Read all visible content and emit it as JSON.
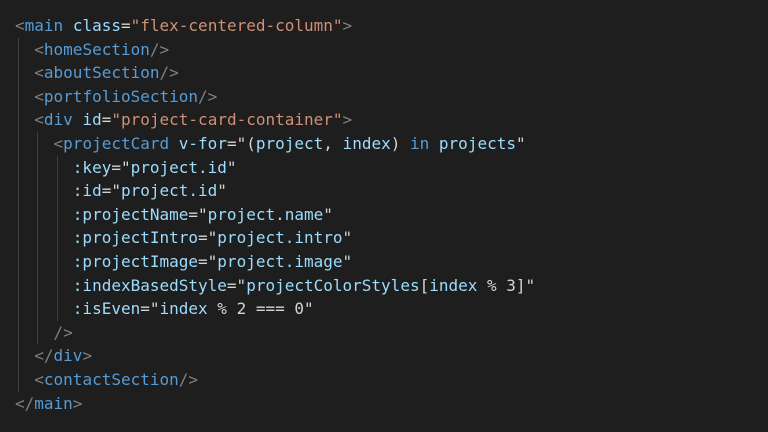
{
  "editor": {
    "language": "vue-html",
    "theme_colors": {
      "background": "#1e1e1e",
      "punctuation": "#808080",
      "tag": "#569cd6",
      "attribute": "#9cdcfe",
      "string": "#ce9178",
      "text": "#d4d4d4",
      "indent_guide": "#404040"
    },
    "lines": [
      {
        "indent": 0,
        "tokens": [
          {
            "t": "punct",
            "v": "<"
          },
          {
            "t": "tag",
            "v": "main"
          },
          {
            "t": "text",
            "v": " "
          },
          {
            "t": "attr",
            "v": "class"
          },
          {
            "t": "text",
            "v": "="
          },
          {
            "t": "str",
            "v": "\"flex-centered-column\""
          },
          {
            "t": "punct",
            "v": ">"
          }
        ]
      },
      {
        "indent": 1,
        "tokens": [
          {
            "t": "punct",
            "v": "<"
          },
          {
            "t": "tag",
            "v": "homeSection"
          },
          {
            "t": "punct",
            "v": "/>"
          }
        ]
      },
      {
        "indent": 1,
        "tokens": [
          {
            "t": "punct",
            "v": "<"
          },
          {
            "t": "tag",
            "v": "aboutSection"
          },
          {
            "t": "punct",
            "v": "/>"
          }
        ]
      },
      {
        "indent": 1,
        "tokens": [
          {
            "t": "punct",
            "v": "<"
          },
          {
            "t": "tag",
            "v": "portfolioSection"
          },
          {
            "t": "punct",
            "v": "/>"
          }
        ]
      },
      {
        "indent": 1,
        "tokens": [
          {
            "t": "punct",
            "v": "<"
          },
          {
            "t": "tag",
            "v": "div"
          },
          {
            "t": "text",
            "v": " "
          },
          {
            "t": "attr",
            "v": "id"
          },
          {
            "t": "text",
            "v": "="
          },
          {
            "t": "str",
            "v": "\"project-card-container\""
          },
          {
            "t": "punct",
            "v": ">"
          }
        ]
      },
      {
        "indent": 2,
        "tokens": [
          {
            "t": "punct",
            "v": "<"
          },
          {
            "t": "tag",
            "v": "projectCard"
          },
          {
            "t": "text",
            "v": " "
          },
          {
            "t": "attr",
            "v": "v-for"
          },
          {
            "t": "text",
            "v": "=\"("
          },
          {
            "t": "var",
            "v": "project"
          },
          {
            "t": "text",
            "v": ", "
          },
          {
            "t": "var",
            "v": "index"
          },
          {
            "t": "text",
            "v": ") "
          },
          {
            "t": "kw",
            "v": "in"
          },
          {
            "t": "text",
            "v": " "
          },
          {
            "t": "var",
            "v": "projects"
          },
          {
            "t": "text",
            "v": "\""
          }
        ]
      },
      {
        "indent": 3,
        "tokens": [
          {
            "t": "attr",
            "v": ":key"
          },
          {
            "t": "text",
            "v": "=\""
          },
          {
            "t": "var",
            "v": "project.id"
          },
          {
            "t": "text",
            "v": "\""
          }
        ]
      },
      {
        "indent": 3,
        "tokens": [
          {
            "t": "attr",
            "v": ":id"
          },
          {
            "t": "text",
            "v": "=\""
          },
          {
            "t": "var",
            "v": "project.id"
          },
          {
            "t": "text",
            "v": "\""
          }
        ]
      },
      {
        "indent": 3,
        "tokens": [
          {
            "t": "attr",
            "v": ":projectName"
          },
          {
            "t": "text",
            "v": "=\""
          },
          {
            "t": "var",
            "v": "project.name"
          },
          {
            "t": "text",
            "v": "\""
          }
        ]
      },
      {
        "indent": 3,
        "tokens": [
          {
            "t": "attr",
            "v": ":projectIntro"
          },
          {
            "t": "text",
            "v": "=\""
          },
          {
            "t": "var",
            "v": "project.intro"
          },
          {
            "t": "text",
            "v": "\""
          }
        ]
      },
      {
        "indent": 3,
        "tokens": [
          {
            "t": "attr",
            "v": ":projectImage"
          },
          {
            "t": "text",
            "v": "=\""
          },
          {
            "t": "var",
            "v": "project.image"
          },
          {
            "t": "text",
            "v": "\""
          }
        ]
      },
      {
        "indent": 3,
        "tokens": [
          {
            "t": "attr",
            "v": ":indexBasedStyle"
          },
          {
            "t": "text",
            "v": "=\""
          },
          {
            "t": "var",
            "v": "projectColorStyles"
          },
          {
            "t": "text",
            "v": "["
          },
          {
            "t": "var",
            "v": "index"
          },
          {
            "t": "text",
            "v": " % 3]\""
          }
        ]
      },
      {
        "indent": 3,
        "tokens": [
          {
            "t": "attr",
            "v": ":isEven"
          },
          {
            "t": "text",
            "v": "=\""
          },
          {
            "t": "var",
            "v": "index"
          },
          {
            "t": "text",
            "v": " % 2 === 0\""
          }
        ]
      },
      {
        "indent": 2,
        "tokens": [
          {
            "t": "punct",
            "v": "/>"
          }
        ]
      },
      {
        "indent": 1,
        "tokens": [
          {
            "t": "punct",
            "v": "</"
          },
          {
            "t": "tag",
            "v": "div"
          },
          {
            "t": "punct",
            "v": ">"
          }
        ]
      },
      {
        "indent": 1,
        "tokens": [
          {
            "t": "punct",
            "v": "<"
          },
          {
            "t": "tag",
            "v": "contactSection"
          },
          {
            "t": "punct",
            "v": "/>"
          }
        ]
      },
      {
        "indent": 0,
        "tokens": [
          {
            "t": "punct",
            "v": "</"
          },
          {
            "t": "tag",
            "v": "main"
          },
          {
            "t": "punct",
            "v": ">"
          }
        ]
      }
    ]
  }
}
